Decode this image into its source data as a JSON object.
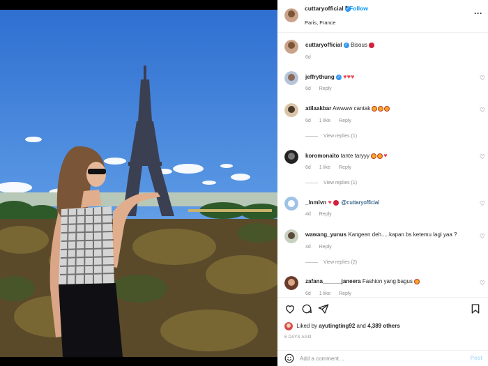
{
  "header": {
    "username": "cuttaryofficial",
    "dot": "•",
    "follow": "Follow",
    "location": "Paris, France",
    "more_icon": "more-horizontal-icon"
  },
  "caption": {
    "username": "cuttaryofficial",
    "text": "Bisous",
    "time": "6d"
  },
  "comments": [
    {
      "username": "jeffrythung",
      "text": "",
      "time": "6d",
      "likes": "",
      "reply": "Reply",
      "view_replies": ""
    },
    {
      "username": "atilaakbar",
      "text": "Awwww cantak",
      "time": "6d",
      "likes": "1 like",
      "reply": "Reply",
      "view_replies": "View replies (1)"
    },
    {
      "username": "koromonaito",
      "text": "tante taryyy",
      "time": "6d",
      "likes": "1 like",
      "reply": "Reply",
      "view_replies": "View replies (1)"
    },
    {
      "username": "_lnmlvn",
      "text": "@cuttaryofficial",
      "time": "4d",
      "likes": "",
      "reply": "Reply",
      "view_replies": ""
    },
    {
      "username": "wawang_yunus",
      "text": "Kangeen deh.....kapan bs ketemu lagi yaa ?",
      "time": "4d",
      "likes": "",
      "reply": "Reply",
      "view_replies": "View replies (2)"
    },
    {
      "username": "zafana______janeera",
      "text": "Fashion yang bagus",
      "time": "6d",
      "likes": "1 like",
      "reply": "Reply",
      "view_replies": ""
    }
  ],
  "likes": {
    "prefix": "Liked by",
    "user": "ayutingting92",
    "conj": "and",
    "others": "4,389 others"
  },
  "date": "6 DAYS AGO",
  "add_comment": {
    "placeholder": "Add a comment…",
    "post": "Post"
  },
  "colors": {
    "accent": "#0095f6",
    "verified": "#3897f0",
    "like_red": "#ed4956"
  }
}
